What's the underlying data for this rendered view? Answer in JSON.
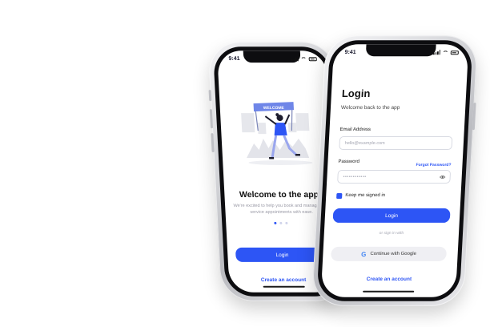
{
  "colors": {
    "accent": "#2d55f5",
    "muted": "#a5a7b3",
    "dark": "#111111"
  },
  "left_phone": {
    "status": {
      "time": "9:41"
    },
    "illustration": {
      "banner_text": "WELCOME"
    },
    "title": "Welcome to the app",
    "subtitle": "We're excited to help you book and manage your service appointments with ease.",
    "pagination": {
      "total": 3,
      "active": 1
    },
    "login_button": "Login",
    "create_account_link": "Create an account"
  },
  "right_phone": {
    "status": {
      "time": "9:41"
    },
    "title": "Login",
    "subtitle": "Welcome back to the app",
    "email": {
      "label": "Email Address",
      "placeholder": "hello@example.com"
    },
    "password": {
      "label": "Password",
      "value": "••••••••••••",
      "forgot_link": "Forgot Password?",
      "toggle_icon": "eye-icon"
    },
    "keep_signed_in": {
      "label": "Keep me signed in",
      "checked": true
    },
    "login_button": "Login",
    "divider_text": "or sign in with",
    "google_button": {
      "label": "Continue with Google",
      "icon": "google-icon"
    },
    "create_account_link": "Create an account"
  }
}
